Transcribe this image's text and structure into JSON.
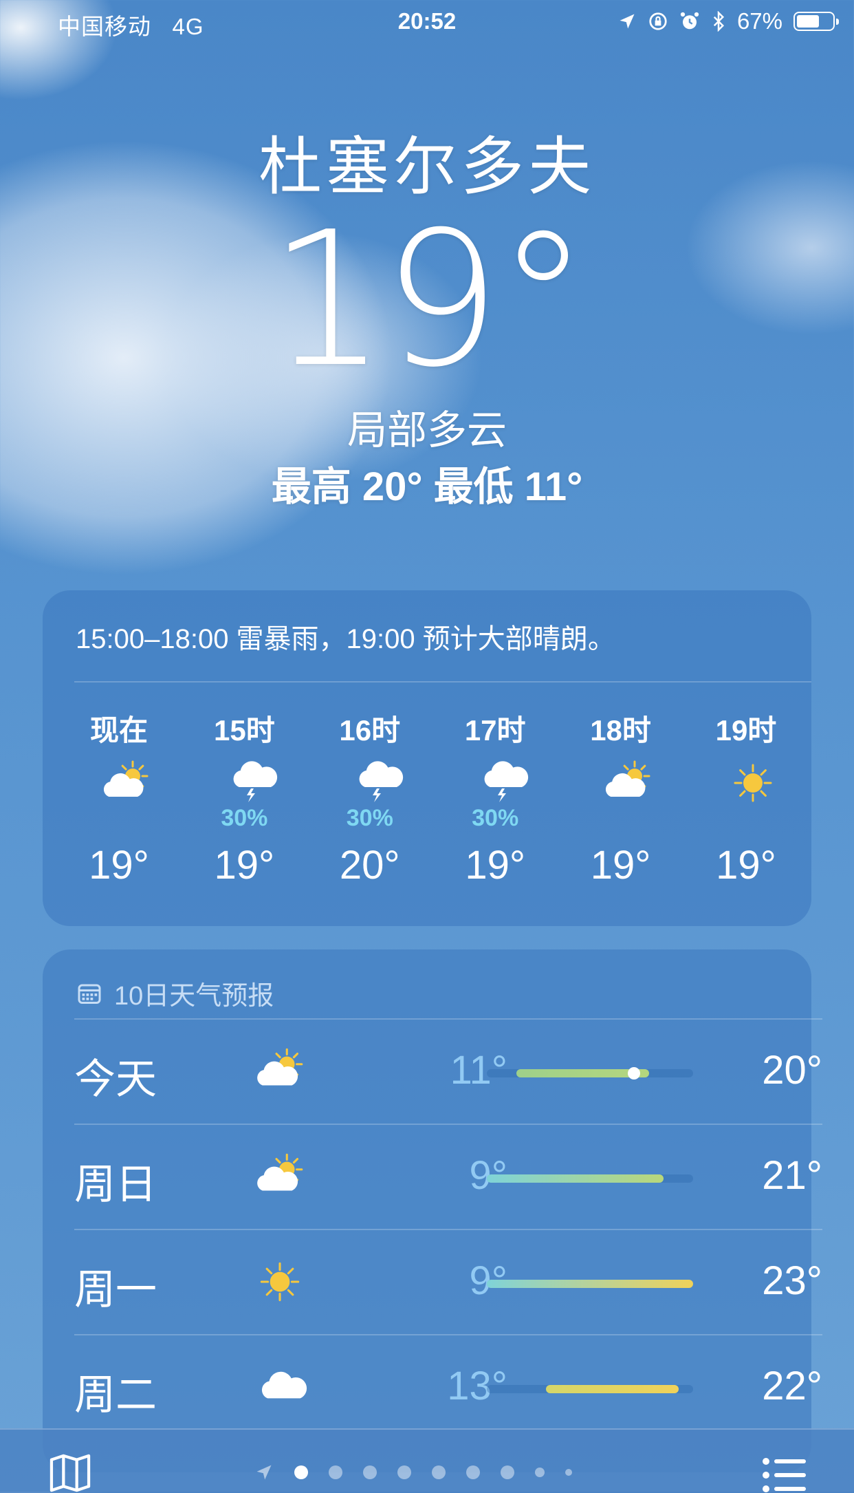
{
  "status_bar": {
    "carrier": "中国移动",
    "network": "4G",
    "time": "20:52",
    "battery": "67%"
  },
  "current": {
    "city": "杜塞尔多夫",
    "temperature": "19°",
    "condition": "局部多云",
    "high_low": "最高 20°  最低 11°"
  },
  "hourly": {
    "summary": "15:00–18:00 雷暴雨，19:00 预计大部晴朗。",
    "items": [
      {
        "label": "现在",
        "icon": "partly-cloudy-icon",
        "prob": "",
        "temp": "19°"
      },
      {
        "label": "15时",
        "icon": "thunderstorm-icon",
        "prob": "30%",
        "temp": "19°"
      },
      {
        "label": "16时",
        "icon": "thunderstorm-icon",
        "prob": "30%",
        "temp": "20°"
      },
      {
        "label": "17时",
        "icon": "thunderstorm-icon",
        "prob": "30%",
        "temp": "19°"
      },
      {
        "label": "18时",
        "icon": "partly-cloudy-icon",
        "prob": "",
        "temp": "19°"
      },
      {
        "label": "19时",
        "icon": "sun-icon",
        "prob": "",
        "temp": "19°"
      }
    ]
  },
  "forecast": {
    "title": "10日天气预报",
    "range_min": 9,
    "range_max": 23,
    "days": [
      {
        "day": "今天",
        "icon": "partly-cloudy-icon",
        "low": "11°",
        "high": "20°",
        "lo_val": 11,
        "hi_val": 20,
        "current": 19,
        "colors": [
          "#9ed08a",
          "#b5d67e"
        ]
      },
      {
        "day": "周日",
        "icon": "partly-cloudy-icon",
        "low": "9°",
        "high": "21°",
        "lo_val": 9,
        "hi_val": 21,
        "current": null,
        "colors": [
          "#7fd3d8",
          "#b9d77a"
        ]
      },
      {
        "day": "周一",
        "icon": "sun-icon",
        "low": "9°",
        "high": "23°",
        "lo_val": 9,
        "hi_val": 23,
        "current": null,
        "colors": [
          "#7fd3d8",
          "#f0d25a"
        ]
      },
      {
        "day": "周二",
        "icon": "cloud-icon",
        "low": "13°",
        "high": "22°",
        "lo_val": 13,
        "hi_val": 22,
        "current": null,
        "colors": [
          "#d4d66a",
          "#f0d25a"
        ]
      }
    ]
  },
  "colors": {
    "accent_prob": "#7fd8f2",
    "sun": "#f6c83e"
  }
}
